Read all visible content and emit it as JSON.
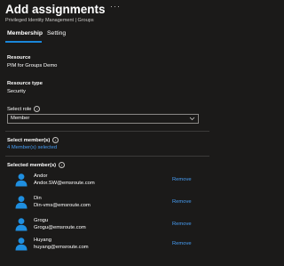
{
  "header": {
    "title": "Add assignments",
    "more_icon": "ellipsis-icon",
    "breadcrumb": "Privileged Identity Management | Groups"
  },
  "tabs": [
    {
      "label": "Membership",
      "active": true
    },
    {
      "label": "Setting",
      "active": false
    }
  ],
  "resource": {
    "label": "Resource",
    "value": "PIM for Groups Demo"
  },
  "resource_type": {
    "label": "Resource type",
    "value": "Security"
  },
  "select_role": {
    "label": "Select role",
    "info_icon": "info-icon",
    "selected": "Member",
    "icon": "chevron-down-icon"
  },
  "select_members": {
    "label": "Select member(s)",
    "info_icon": "info-icon",
    "link_text": "4 Member(s) selected"
  },
  "selected_members": {
    "label": "Selected member(s)",
    "info_icon": "info-icon",
    "remove_label": "Remove",
    "items": [
      {
        "name": "Andor",
        "email": "Andor.SW@emsroute.com"
      },
      {
        "name": "Din",
        "email": "Din-vms@emsroute.com"
      },
      {
        "name": "Grogu",
        "email": "Grogu@emsroute.com"
      },
      {
        "name": "Huyang",
        "email": "huyang@emsroute.com"
      }
    ]
  },
  "colors": {
    "background": "#1b1a19",
    "accent": "#1a86d9",
    "link": "#479ef5",
    "avatar": "#1f8fe0"
  }
}
